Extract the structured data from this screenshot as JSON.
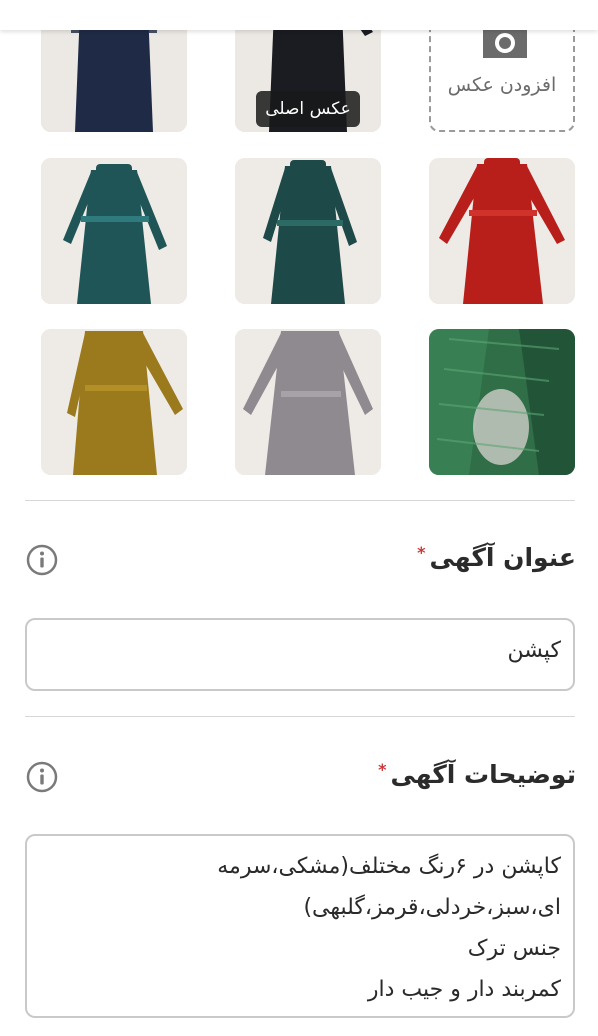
{
  "photos": {
    "add_photo_label": "افزودن عکس",
    "main_photo_label": "عکس اصلی",
    "items": [
      {
        "color_name": "navy",
        "coat_color": "#1f2a46"
      },
      {
        "color_name": "black",
        "coat_color": "#1a1c22"
      },
      {
        "color_name": "teal",
        "coat_color": "#1f5557"
      },
      {
        "color_name": "dark-green",
        "coat_color": "#1d4a48"
      },
      {
        "color_name": "red",
        "coat_color": "#b81f1a"
      },
      {
        "color_name": "mustard",
        "coat_color": "#9a7a1c"
      },
      {
        "color_name": "silver-grey",
        "coat_color": "#8f8a8f"
      },
      {
        "color_name": "green-closeup",
        "coat_color": "#2f6e46"
      }
    ]
  },
  "ad_title": {
    "label": "عنوان آگهی",
    "required_mark": "*",
    "value": "کپشن",
    "info_icon": "info-circle-icon"
  },
  "ad_description": {
    "label": "توضیحات آگهی",
    "required_mark": "*",
    "value": "کاپشن در ۶رنگ مختلف(مشکی،سرمه\nای،سبز،خردلی،قرمز،گلبهی)\nجنس ترک\nکمربند دار و جیب دار",
    "info_icon": "info-circle-icon"
  },
  "colors": {
    "required": "#c93a3a",
    "border": "#c9c9c9",
    "divider": "#d7d7d7"
  }
}
